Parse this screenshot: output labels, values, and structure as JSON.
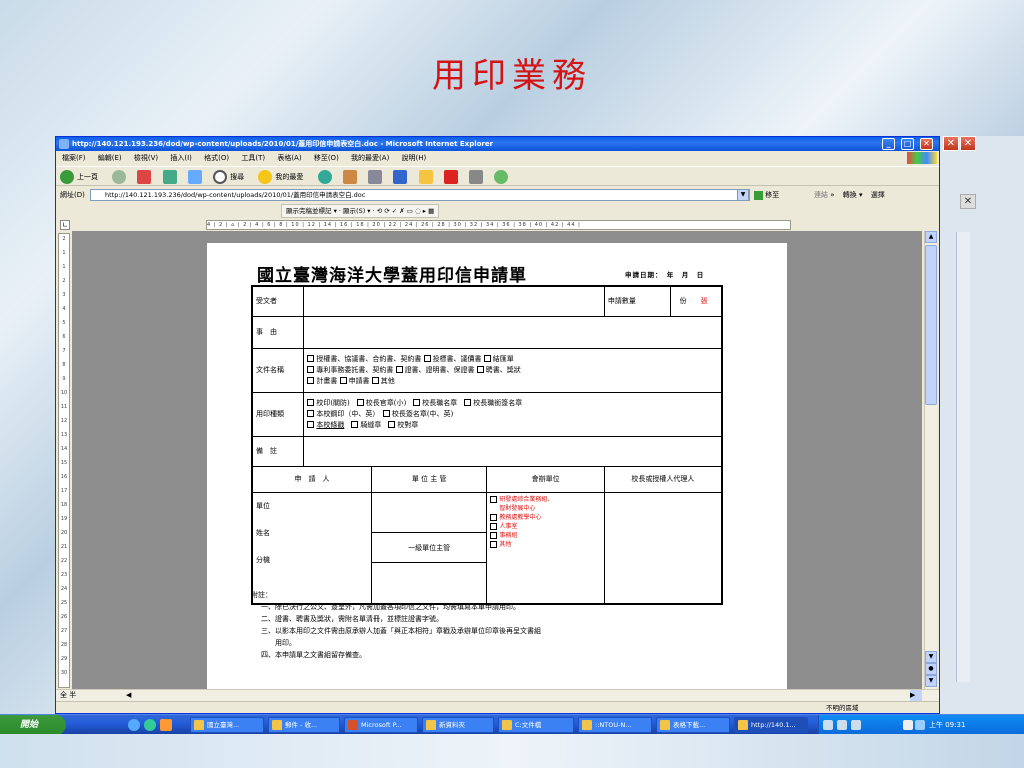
{
  "slide": {
    "title": "用印業務"
  },
  "window": {
    "title": "http://140.121.193.236/dod/wp-content/uploads/2010/01/蓋用印信申請表空白.doc - Microsoft Internet Explorer",
    "menu": [
      "檔案(F)",
      "編輯(E)",
      "檢視(V)",
      "插入(I)",
      "格式(O)",
      "工具(T)",
      "表格(A)",
      "移至(O)",
      "我的最愛(A)",
      "說明(H)"
    ],
    "toolbar": {
      "back": "上一頁",
      "search": "搜尋",
      "favorites": "我的最愛"
    },
    "address_label": "網址(D)",
    "address": "http://140.121.193.236/dod/wp-content/uploads/2010/01/蓋用印信申請表空白.doc",
    "go": "移至",
    "links": "連結",
    "convert": "轉換",
    "select": "選擇",
    "word_toolbar": {
      "show_markup": "顯示完稿並標記",
      "show": "顯示(S)"
    },
    "ruler": "4 | 2 | ⌂ | 2 | 4 | 6 | 8 | 10 | 12 | 14 | 16 | 18 | 20 | 22 | 24 | 26 | 28 | 30 | 32 | 34 | 36 | 38 | 40 | 42 | 44 |",
    "vruler": [
      "2",
      "1",
      "1",
      "2",
      "3",
      "4",
      "5",
      "6",
      "7",
      "8",
      "9",
      "10",
      "11",
      "12",
      "13",
      "14",
      "15",
      "16",
      "17",
      "18",
      "19",
      "20",
      "21",
      "22",
      "23",
      "24",
      "25",
      "26",
      "27",
      "28",
      "29",
      "30"
    ],
    "status": "不明的區域",
    "ime": "全 半"
  },
  "doc": {
    "title": "國立臺灣海洋大學蓋用印信申請單",
    "date": "申請日期：　年　月　日",
    "rows": {
      "receiver": "受文者",
      "qty_label": "申請數量",
      "qty_unit": "份",
      "qty_unit2": "張",
      "matter": "事　由",
      "docname": "文件名稱",
      "doc_opts": [
        "授權書、協議書、合約書、契約書",
        "投標書、議價書",
        "結匯單",
        "專利事務委託書、契約書",
        "證書、證明書、保證書",
        "聘書、獎狀",
        "計畫書",
        "申請書",
        "其他"
      ],
      "seal": "用印種類",
      "seal_opts": [
        "校印(關防)",
        "校長官章(小)",
        "校長職名章",
        "校長職銜簽名章",
        "本校鋼印（中、英）",
        "校長簽名章(中、英)",
        "本校條戳",
        "騎縫章",
        "校對章"
      ],
      "remark": "備　註",
      "applicant": "申　請　人",
      "unit_head": "單 位 主 管",
      "co_unit": "會辦單位",
      "president": "校長或授權人代理人",
      "unit": "單位",
      "name": "姓名",
      "ext": "分機",
      "senior_head": "一級單位主管",
      "co_opts": [
        "研發處綜合業務組、",
        "智財發展中心",
        "教務處教學中心",
        "人事室",
        "事務組",
        "其他"
      ]
    },
    "notes": [
      "附註：",
      "一、除已決行之公文、簽呈外，凡需加蓋各項印信之文件，均需填寫本單申請用印。",
      "二、證書、聘書及獎狀，需附名單清冊，並標註證書字號。",
      "三、以影本用印之文件需由原承辦人加蓋「與正本相符」章戳及承辦單位印章後再呈文書組",
      "　　用印。",
      "四、本申請單之文書組留存備查。"
    ]
  },
  "taskbar": {
    "start": "開始",
    "items": [
      "國立臺灣...",
      "郵件 - 收...",
      "Microsoft P...",
      "新資料夾",
      "C:文件檔",
      "::NTOU-N...",
      "表格下載...",
      "http://140.1..."
    ],
    "clock": "上午 09:31"
  }
}
